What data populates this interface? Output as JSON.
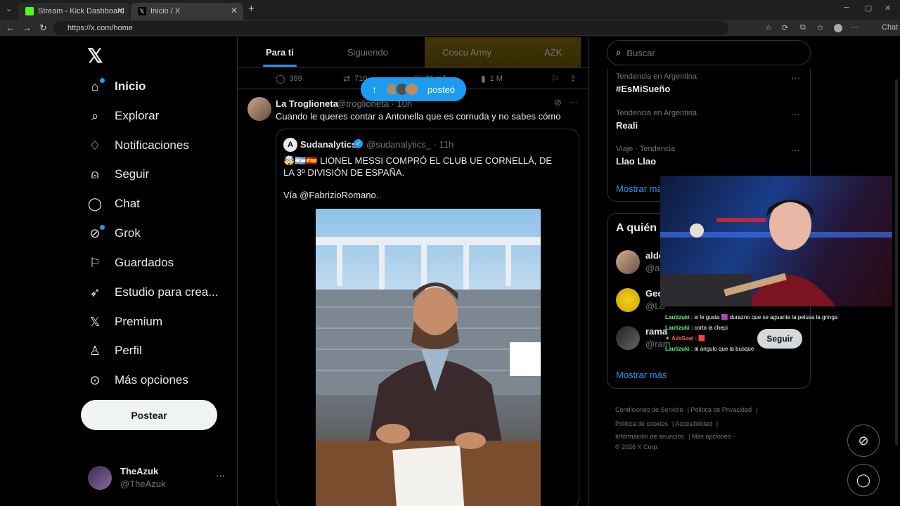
{
  "browser": {
    "tabs": [
      {
        "title": "Stream - Kick Dashboard",
        "favicon_color": "#53fc18"
      },
      {
        "title": "Inicio / X",
        "favicon_color": "#ffffff"
      }
    ],
    "url": "https://x.com/home",
    "chat_button": "Chat"
  },
  "sidebar": {
    "logo": "X",
    "items": [
      {
        "label": "Inicio",
        "icon": "home-icon"
      },
      {
        "label": "Explorar",
        "icon": "search-icon"
      },
      {
        "label": "Notificaciones",
        "icon": "bell-icon"
      },
      {
        "label": "Seguir",
        "icon": "add-user-icon"
      },
      {
        "label": "Chat",
        "icon": "chat-icon"
      },
      {
        "label": "Grok",
        "icon": "grok-icon"
      },
      {
        "label": "Guardados",
        "icon": "bookmark-icon"
      },
      {
        "label": "Estudio para crea...",
        "icon": "rocket-icon"
      },
      {
        "label": "Premium",
        "icon": "x-icon"
      },
      {
        "label": "Perfil",
        "icon": "user-icon"
      },
      {
        "label": "Más opciones",
        "icon": "more-icon"
      }
    ],
    "post_button": "Postear",
    "user": {
      "name": "TheAzuk",
      "handle": "@TheAzuk"
    }
  },
  "feed": {
    "tabs": [
      "Para ti",
      "Siguiendo",
      "Coscu Army",
      "AZK"
    ],
    "prev_actions": {
      "replies": "399",
      "retweets": "710",
      "likes": "21 mil",
      "views": "1 M"
    },
    "new_posts_pill": "posteó",
    "tweet": {
      "name": "La Troglioneta",
      "handle": "@troglioneta · 10h",
      "text": "Cuando le queres contar a Antonella que es cornuda y no sabes cómo",
      "quote": {
        "name": "Sudanalytics",
        "handle": "@sudanalytics_ · 11h",
        "text": "🤯🇦🇷🇪🇸 LIONEL MESSI COMPRÓ EL CLUB UE CORNELLÀ, DE LA 3º DIVISIÓN DE ESPAÑA.",
        "via": "Vía @FabrizioRomano."
      }
    }
  },
  "right": {
    "search_placeholder": "Buscar",
    "trends": [
      {
        "meta": "Tendencia en Argentina",
        "title": "#EsMiSueño"
      },
      {
        "meta": "Tendencia en Argentina",
        "title": "Reali"
      },
      {
        "meta": "Viaje · Tendencia",
        "title": "Llao Llao"
      }
    ],
    "show_more_trends": "Mostrar más",
    "who_title": "A quién",
    "who": [
      {
        "name": "aldo",
        "handle": "@ald"
      },
      {
        "name": "Geol",
        "handle": "@Lo"
      },
      {
        "name": "rama",
        "handle": "@ram"
      }
    ],
    "follow_button": "Seguir",
    "show_more_who": "Mostrar más",
    "footer": [
      "Condiciones de Servicio",
      "Política de Privacidad",
      "Política de cookies",
      "Accesibilidad",
      "Información de anuncios",
      "Más opciones ···",
      "© 2026 X Corp."
    ]
  },
  "stream_chat": [
    {
      "user": "Lautizuki",
      "msg": "si le gusta 🟪 durazno que se aguante la pelusa la gringa"
    },
    {
      "user": "Lautizuki",
      "msg": "corta la chepi"
    },
    {
      "user": "AzkGael",
      "msg": "🟥"
    },
    {
      "user": "Lautizuki",
      "msg": "al angulo que la busque"
    }
  ]
}
